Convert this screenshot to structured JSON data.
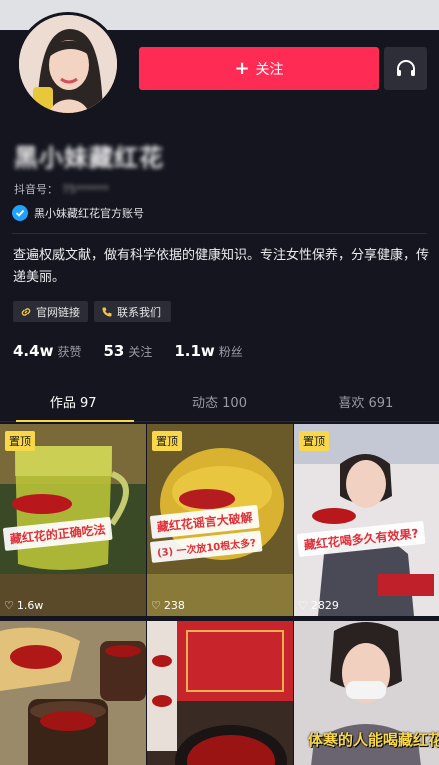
{
  "profile": {
    "nickname": "黑小妹藏红花",
    "account_label": "抖音号：",
    "account_id": "75******",
    "verified_text": "黑小妹藏红花官方账号",
    "bio": "查遍权威文献，做有科学依据的健康知识。专注女性保养，分享健康，传递美丽。",
    "chips": [
      {
        "label": "官网链接",
        "icon": "link-icon"
      },
      {
        "label": "联系我们",
        "icon": "phone-icon"
      }
    ],
    "stats": [
      {
        "value": "4.4w",
        "label": "获赞"
      },
      {
        "value": "53",
        "label": "关注"
      },
      {
        "value": "1.1w",
        "label": "粉丝"
      }
    ]
  },
  "actions": {
    "follow_label": "关注",
    "more_icon": "headset-icon"
  },
  "tabs": [
    {
      "label": "作品 97",
      "active": true
    },
    {
      "label": "动态 100",
      "active": false
    },
    {
      "label": "喜欢 691",
      "active": false
    }
  ],
  "videos": [
    {
      "pinned_label": "置顶",
      "caption": "藏红花的正确吃法",
      "likes": "1.6w"
    },
    {
      "pinned_label": "置顶",
      "caption": "藏红花谣言大破解",
      "sub_caption": "(3) 一次放10根太多?",
      "likes": "238"
    },
    {
      "pinned_label": "置顶",
      "caption": "藏红花喝多久有效果?",
      "likes": "2829"
    },
    {
      "caption": ""
    },
    {
      "caption": ""
    },
    {
      "caption": "体寒的人能喝藏红花吗?"
    }
  ],
  "colors": {
    "background": "#15151f",
    "follow": "#fe2c55",
    "pin": "#f8d84a",
    "verified": "#20a0ff"
  }
}
